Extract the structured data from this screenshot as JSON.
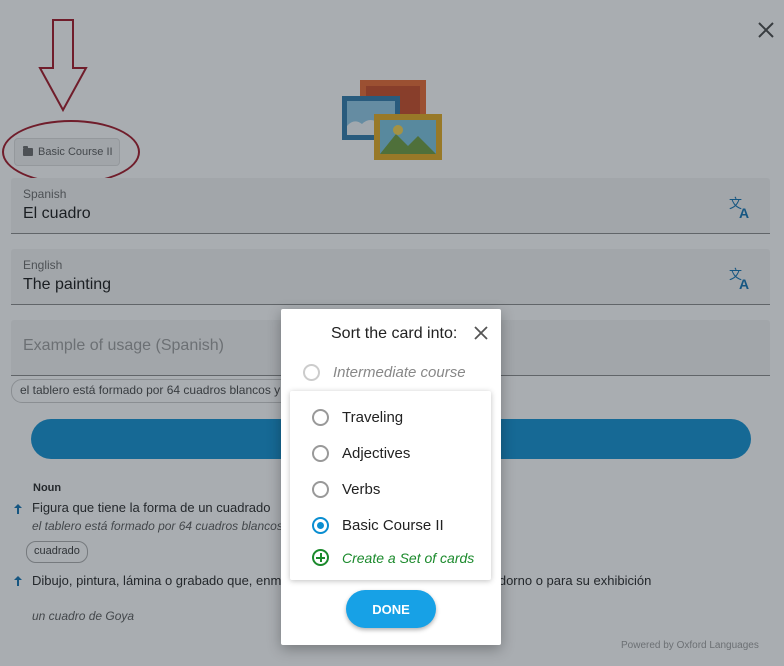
{
  "folder_chip": {
    "label": "Basic Course II",
    "icon": "folder-icon"
  },
  "fields": {
    "spanish": {
      "label": "Spanish",
      "value": "El cuadro"
    },
    "english": {
      "label": "English",
      "value": "The painting"
    },
    "example": {
      "placeholder": "Example of usage (Spanish)"
    }
  },
  "example_chip": "el tablero está formado por 64 cuadros blancos y negros",
  "definitions": {
    "pos": "Noun",
    "items": [
      {
        "text": "Figura que tiene la forma de un cuadrado",
        "example": "el tablero está formado por 64 cuadros blancos y negros"
      },
      {
        "text": "Dibujo, pintura, lámina o grabado que, enmarcado, se cuelga en la pared como adorno o para su exhibición",
        "example": "un cuadro de Goya"
      }
    ],
    "pill": "cuadrado"
  },
  "powered_by": "Powered by Oxford Languages",
  "dialog": {
    "title": "Sort the card into:",
    "disabled_option": "Intermediate course",
    "options": [
      {
        "label": "Traveling",
        "selected": false
      },
      {
        "label": "Adjectives",
        "selected": false
      },
      {
        "label": "Verbs",
        "selected": false
      },
      {
        "label": "Basic Course II",
        "selected": true
      }
    ],
    "create_label": "Create a Set of cards",
    "done_label": "DONE"
  },
  "colors": {
    "accent": "#0a8ed1",
    "create": "#1b8a2c",
    "annotation": "#a01020"
  }
}
